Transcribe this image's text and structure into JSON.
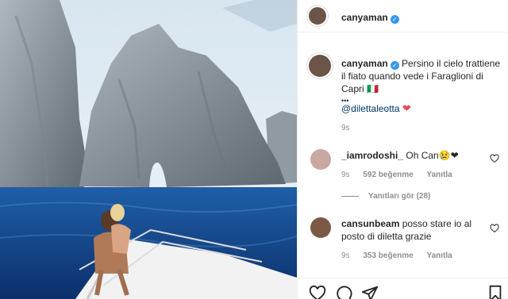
{
  "post": {
    "author": "canyaman",
    "verified_mark": "✓",
    "caption_author": "canyaman",
    "caption": "Persino il cielo trattiene il fiato quando vede i Faraglioni di Capri 🇮🇹",
    "caption_more": "•••",
    "mention": "@dilettaleotta",
    "heart": "❤",
    "caption_time": "9s"
  },
  "comments": [
    {
      "user": "_iamrodoshi_",
      "text": "Oh Can😢❤",
      "time": "9s",
      "likes": "592 beğenme",
      "reply": "Yanıtla",
      "view_replies": "Yanıtları gör (28)"
    },
    {
      "user": "cansunbeam",
      "text": "posso stare io al posto di diletta grazie",
      "time": "9s",
      "likes": "353 beğenme",
      "reply": "Yanıtla"
    }
  ],
  "icons": {
    "like": "heart-outline-icon",
    "comment": "comment-icon",
    "share": "send-icon",
    "save": "bookmark-icon"
  },
  "colors": {
    "link": "#00376b",
    "verified": "#3897f0",
    "heart": "#ed4956",
    "muted": "#8e8e8e"
  }
}
